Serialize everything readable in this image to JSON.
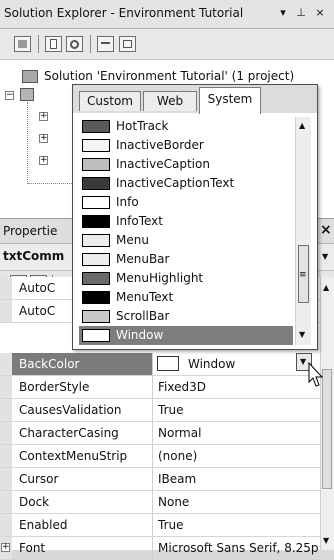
{
  "solution_explorer": {
    "title": "Solution Explorer - Environment Tutorial",
    "pin_glyph": "▾",
    "autohide_glyph": "⊥",
    "close_glyph": "×",
    "toolbar_icons": [
      "properties-icon",
      "show-all-files-icon",
      "refresh-icon",
      "view-code-icon",
      "view-designer-icon"
    ],
    "tree": {
      "solution_label": "Solution 'Environment Tutorial' (1 project)"
    }
  },
  "properties": {
    "title": "Propertie",
    "object_name": "txtComm",
    "close_glyph": "×",
    "rows": [
      {
        "name": "AutoC",
        "value": "",
        "expandable": false
      },
      {
        "name": "AutoC",
        "value": "",
        "expandable": false
      },
      {
        "name": "BackColor",
        "value": "Window",
        "expandable": false,
        "selected": true
      },
      {
        "name": "BorderStyle",
        "value": "Fixed3D",
        "expandable": false
      },
      {
        "name": "CausesValidation",
        "value": "True",
        "expandable": false
      },
      {
        "name": "CharacterCasing",
        "value": "Normal",
        "expandable": false
      },
      {
        "name": "ContextMenuStrip",
        "value": "(none)",
        "expandable": false
      },
      {
        "name": "Cursor",
        "value": "IBeam",
        "expandable": false
      },
      {
        "name": "Dock",
        "value": "None",
        "expandable": false
      },
      {
        "name": "Enabled",
        "value": "True",
        "expandable": false
      },
      {
        "name": "Font",
        "value": "Microsoft Sans Serif, 8.25pt",
        "expandable": true
      }
    ]
  },
  "color_picker": {
    "tabs": [
      {
        "label": "Custom",
        "active": false
      },
      {
        "label": "Web",
        "active": false
      },
      {
        "label": "System",
        "active": true
      }
    ],
    "items": [
      {
        "label": "HotTrack",
        "color": "#5a5a5a"
      },
      {
        "label": "InactiveBorder",
        "color": "#f4f4f4"
      },
      {
        "label": "InactiveCaption",
        "color": "#bebebe"
      },
      {
        "label": "InactiveCaptionText",
        "color": "#3a3a3a"
      },
      {
        "label": "Info",
        "color": "#ffffff"
      },
      {
        "label": "InfoText",
        "color": "#000000"
      },
      {
        "label": "Menu",
        "color": "#ececec"
      },
      {
        "label": "MenuBar",
        "color": "#ececec"
      },
      {
        "label": "MenuHighlight",
        "color": "#6a6a6a"
      },
      {
        "label": "MenuText",
        "color": "#000000"
      },
      {
        "label": "ScrollBar",
        "color": "#c8c8c8"
      },
      {
        "label": "Window",
        "color": "#ffffff",
        "selected": true
      }
    ],
    "scroll_up_glyph": "▲",
    "scroll_down_glyph": "▼",
    "scroll_grip_glyph": "≡"
  },
  "dropdown_glyph": "▼",
  "grid_scroll_up_glyph": "▲",
  "grid_scroll_down_glyph": "▼"
}
